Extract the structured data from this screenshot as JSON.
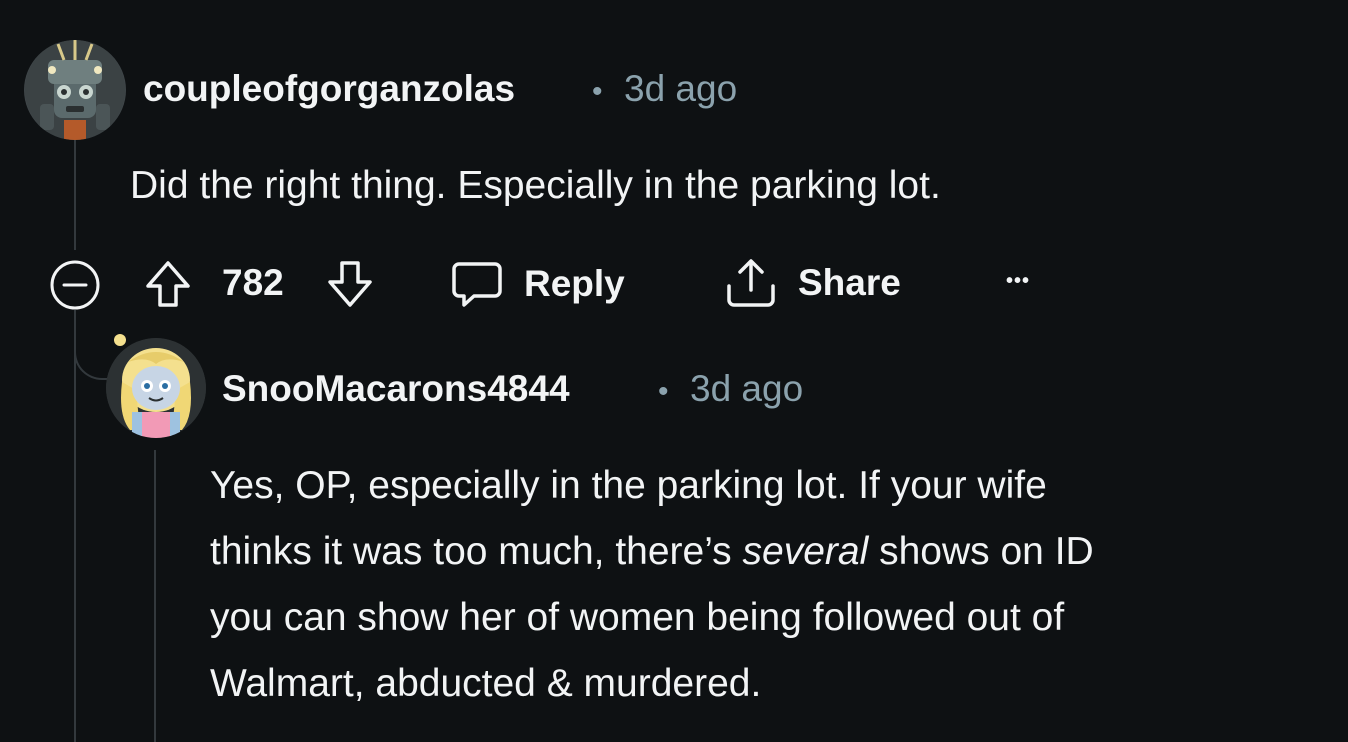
{
  "comment": {
    "username": "coupleofgorganzolas",
    "separator": "•",
    "timestamp": "3d ago",
    "body": "Did the right thing. Especially in the parking lot.",
    "actions": {
      "score": "782",
      "reply_label": "Reply",
      "share_label": "Share",
      "more_label": "•••"
    }
  },
  "reply": {
    "username": "SnooMacarons4844",
    "separator": "•",
    "timestamp": "3d ago",
    "body_lines": [
      {
        "text": "Yes, OP, especially in the parking lot. If your wife"
      },
      {
        "pre": "thinks it was too much, there’s ",
        "em": "several",
        "post": " shows on ID"
      },
      {
        "text": "you can show her of women being followed out of"
      },
      {
        "text": "Walmart, abducted & murdered."
      }
    ]
  },
  "colors": {
    "background": "#0e1113",
    "text": "#f2f4f5",
    "meta": "#8ba2ad",
    "thread_line": "#33393d"
  }
}
